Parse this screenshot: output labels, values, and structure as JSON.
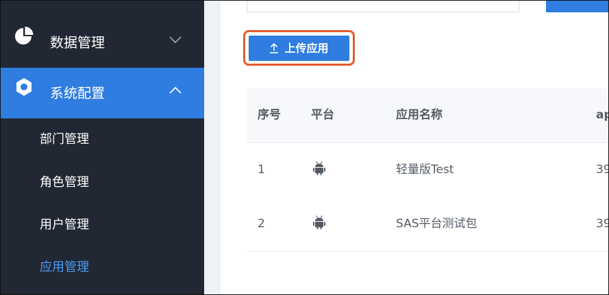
{
  "sidebar": {
    "menus": [
      {
        "label": "数据管理",
        "icon": "pie-chart-icon",
        "state": "collapsed"
      },
      {
        "label": "系统配置",
        "icon": "hexagon-settings-icon",
        "state": "expanded"
      }
    ],
    "submenu": [
      {
        "label": "部门管理"
      },
      {
        "label": "角色管理"
      },
      {
        "label": "用户管理"
      },
      {
        "label": "应用管理",
        "active": true
      }
    ]
  },
  "toolbar": {
    "upload_label": "上传应用",
    "upload_icon": "upload-arrow-icon"
  },
  "table": {
    "headers": [
      "序号",
      "平台",
      "应用名称",
      "ap"
    ],
    "rows": [
      {
        "index": "1",
        "platform_icon": "android-icon",
        "name": "轻量版Test",
        "extra": "39"
      },
      {
        "index": "2",
        "platform_icon": "android-icon",
        "name": "SAS平台测试包",
        "extra": "39"
      }
    ]
  },
  "colors": {
    "sidebar_bg": "#222833",
    "accent": "#2f7de1",
    "active_text": "#4d9bf5",
    "highlight_border": "#e45b2d"
  }
}
